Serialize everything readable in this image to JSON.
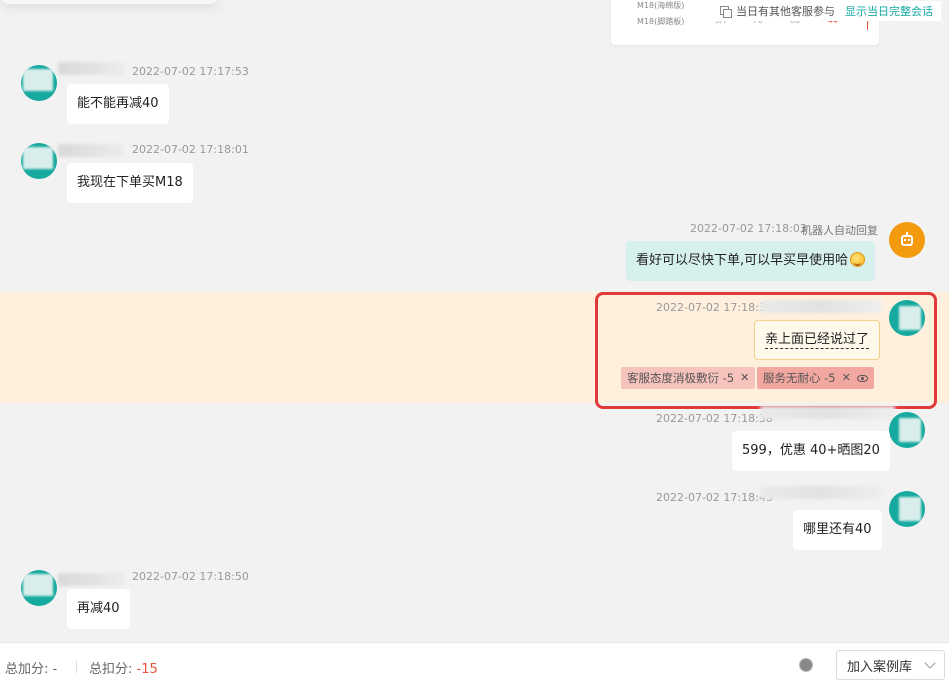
{
  "product_card": {
    "row1": "M18(海绵版)",
    "row2": "M18(脚踏板)",
    "cells": [
      "5/7",
      "70",
      "80",
      "44"
    ]
  },
  "notice": {
    "text": "当日有其他客服参与",
    "link": "显示当日完整会话"
  },
  "messages": [
    {
      "time": "2022-07-02 17:17:53",
      "text": "能不能再减40"
    },
    {
      "time": "2022-07-02 17:18:01",
      "text": "我现在下单买M18"
    },
    {
      "time": "2022-07-02 17:18:03",
      "tag": "机器人自动回复",
      "text": "看好可以尽快下单,可以早买早使用哈"
    },
    {
      "time": "2022-07-02 17:18:31",
      "text": "亲上面已经说过了",
      "tags": [
        {
          "label": "客服态度消极敷衍 -5"
        },
        {
          "label": "服务无耐心 -5"
        }
      ]
    },
    {
      "time": "2022-07-02 17:18:38",
      "text": "599，优惠 40+晒图20"
    },
    {
      "time": "2022-07-02 17:18:43",
      "text": "哪里还有40"
    },
    {
      "time": "2022-07-02 17:18:50",
      "text": "再减40"
    }
  ],
  "bottom": {
    "plus_label": "总加分:",
    "plus_value": "-",
    "minus_label": "总扣分:",
    "minus_value": "-15",
    "case_button": "加入案例库"
  },
  "colors": {
    "teal": "#16a99f",
    "robot": "#f39a0e",
    "highlight": "#fff0de",
    "frame": "#e03a3a",
    "tag": "#f6c3bd"
  }
}
